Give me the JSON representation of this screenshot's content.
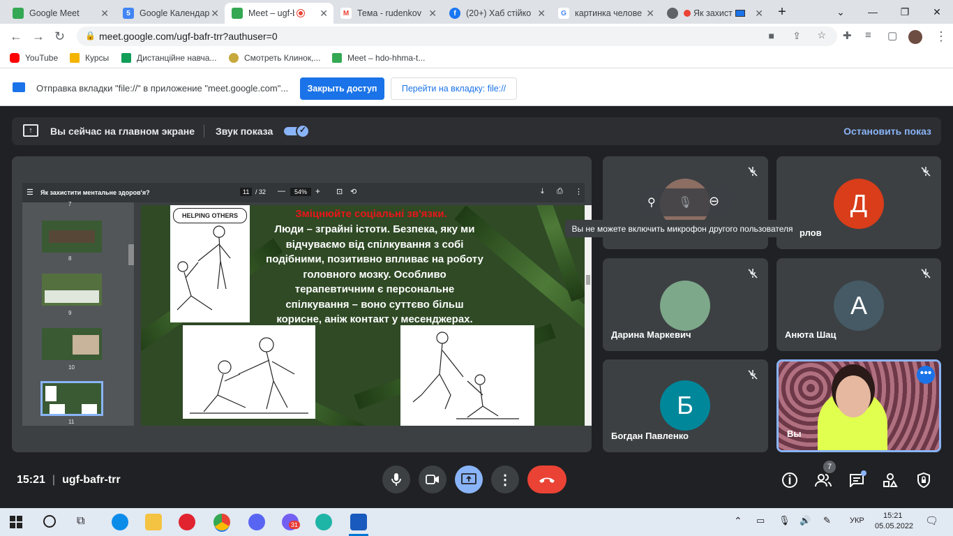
{
  "browser": {
    "tabs": [
      {
        "title": "Google Meet",
        "color": "#34a853",
        "glyph": ""
      },
      {
        "title": "Google Календар",
        "color": "#4285f4",
        "glyph": "5"
      },
      {
        "title": "Meet – ugf-b",
        "color": "#34a853",
        "glyph": ""
      },
      {
        "title": "Тема - rudenkov",
        "color": "#ea4335",
        "glyph": "M"
      },
      {
        "title": "(20+) Хаб стійко",
        "color": "#1877f2",
        "glyph": "f"
      },
      {
        "title": "картинка челове",
        "color": "#ffffff",
        "glyph": "G"
      },
      {
        "title": "Як захист",
        "color": "#5f6368",
        "glyph": ""
      }
    ],
    "url": "meet.google.com/ugf-bafr-trr?authuser=0",
    "bookmarks": [
      {
        "label": "YouTube",
        "color": "#ff0000"
      },
      {
        "label": "Курсы",
        "color": "#f4b400"
      },
      {
        "label": "Дистанційне навча...",
        "color": "#0f9d58"
      },
      {
        "label": "Смотреть Клинок,...",
        "color": "#c7a83c"
      },
      {
        "label": "Meet – hdo-hhma-t...",
        "color": "#34a853"
      }
    ]
  },
  "infobar": {
    "message": "Отправка вкладки \"file://\" в приложение \"meet.google.com\"...",
    "primary": "Закрыть доступ",
    "secondary": "Перейти на вкладку: file://"
  },
  "meetbar": {
    "main_screen": "Вы сейчас на главном экране",
    "sound": "Звук показа",
    "stop": "Остановить показ"
  },
  "pdf": {
    "title": "Як захистити ментальне здоров'я?",
    "page": "11",
    "total": "/ 32",
    "zoom": "54%",
    "thumbs": [
      "7",
      "8",
      "9",
      "10",
      "11"
    ],
    "slide_head": "Зміцнюйте соціальні зв'язки.",
    "slide_body": "Люди – зграйні істоти. Безпека, яку ми відчуваємо від спілкування з собі подібними, позитивно впливає на роботу головного мозку. Особливо терапевтичним є персональне спілкування – воно суттєво більш корисне, аніж контакт у месенджерах.",
    "helping": "HELPING OTHERS"
  },
  "participants": [
    {
      "name": "",
      "initial": "",
      "color": "#8d6e63"
    },
    {
      "name": "а Орлов",
      "initial": "Д",
      "color": "#d93d1a"
    },
    {
      "name": "Дарина Маркевич",
      "initial": "",
      "color": "#7da88a"
    },
    {
      "name": "Анюта Шац",
      "initial": "А",
      "color": "#455a64"
    },
    {
      "name": "Богдан Павленко",
      "initial": "Б",
      "color": "#00879a"
    },
    {
      "name": "Вы",
      "initial": "",
      "color": "#8a4a5c"
    }
  ],
  "tooltip": "Вы не можете включить микрофон другого пользователя",
  "bottom": {
    "time": "15:21",
    "meeting_code": "ugf-bafr-trr",
    "people_count": "7"
  },
  "taskbar": {
    "lang": "УКР",
    "time": "15:21",
    "date": "05.05.2022",
    "viber_badge": "31"
  }
}
